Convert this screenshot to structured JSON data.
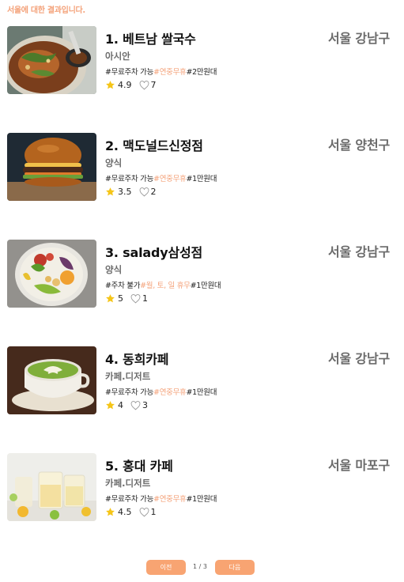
{
  "header": {
    "text": "서울에 대한 결과입니다."
  },
  "results": [
    {
      "title": "1. 베트남 쌀국수",
      "location": "서울 강남구",
      "category": "아시안",
      "tag_a": "#무료주차 가능",
      "tag_b": "#연중무휴",
      "tag_c": "#2만원대",
      "rating": "4.9",
      "likes": "7",
      "image": "noodle-soup-photo"
    },
    {
      "title": "2. 맥도널드신정점",
      "location": "서울 양천구",
      "category": "양식",
      "tag_a": "#무료주차 가능",
      "tag_b": "#연중무휴",
      "tag_c": "#1만원대",
      "rating": "3.5",
      "likes": "2",
      "image": "burger-photo"
    },
    {
      "title": "3. salady삼성점",
      "location": "서울 강남구",
      "category": "양식",
      "tag_a": "#주차 불가",
      "tag_b": "#월, 토, 일 휴무",
      "tag_c": "#1만원대",
      "rating": "5",
      "likes": "1",
      "image": "salad-bowl-photo"
    },
    {
      "title": "4. 동희카페",
      "location": "서울 강남구",
      "category": "카페.디저트",
      "tag_a": "#무료주차 가능",
      "tag_b": "#연중무휴",
      "tag_c": "#1만원대",
      "rating": "4",
      "likes": "3",
      "image": "matcha-latte-photo"
    },
    {
      "title": "5. 홍대 카페",
      "location": "서울 마포구",
      "category": "카페.디저트",
      "tag_a": "#무료주차 가능",
      "tag_b": "#연중무휴",
      "tag_c": "#1만원대",
      "rating": "4.5",
      "likes": "1",
      "image": "citrus-drinks-photo"
    }
  ],
  "pagination": {
    "prev_label": "이전",
    "page_info": "1 / 3",
    "next_label": "다음"
  },
  "colors": {
    "accent": "#f4a27a",
    "button": "#f8a472",
    "star": "#f5c518",
    "muted_text": "#6b6b6b"
  }
}
